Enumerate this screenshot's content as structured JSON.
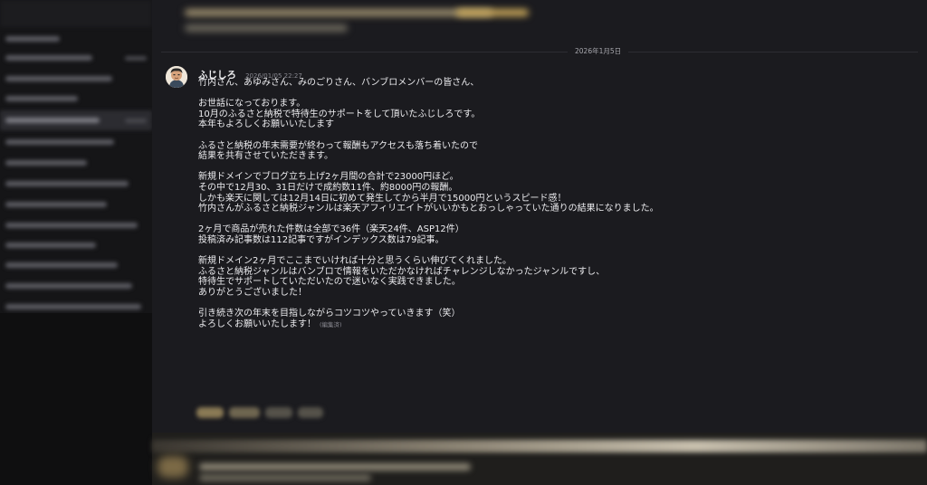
{
  "date_divider": "2026年1月5日",
  "message": {
    "author": "ふじしろ",
    "timestamp": "2026/01/05 22:27",
    "avatar_icon": "user-avatar-icon",
    "lines": [
      "竹内さん、あゆみさん、みのごりさん、バンブロメンバーの皆さん、",
      "",
      "お世話になっております。",
      "10月のふるさと納税で特待生のサポートをして頂いたふじしろです。",
      "本年もよろしくお願いいたします",
      "",
      "ふるさと納税の年末需要が終わって報酬もアクセスも落ち着いたので",
      "結果を共有させていただきます。",
      "",
      "新規ドメインでブログ立ち上げ2ヶ月間の合計で23000円ほど。",
      "その中で12月30、31日だけで成約数11件、約8000円の報酬。",
      "しかも楽天に関しては12月14日に初めて発生してから半月で15000円というスピード感！",
      "竹内さんがふるさと納税ジャンルは楽天アフィリエイトがいいかもとおっしゃっていた通りの結果になりました。",
      "",
      "2ヶ月で商品が売れた件数は全部で36件（楽天24件、ASP12件）",
      "投稿済み記事数は112記事ですがインデックス数は79記事。",
      "",
      "新規ドメイン2ヶ月でここまでいければ十分と思うくらい伸びてくれました。",
      "ふるさと納税ジャンルはバンブロで情報をいただかなければチャレンジしなかったジャンルですし、",
      "特待生でサポートしていただいたので迷いなく実践できました。",
      "ありがとうございました！",
      "",
      "引き続き次の年末を目指しながらコツコツやっていきます（笑）"
    ],
    "last_line": "よろしくお願いいたします！",
    "edited_label": "(編集済)"
  },
  "colors": {
    "background": "#1b1b1f",
    "sidebar": "#151517",
    "text": "#ececef",
    "muted": "#8a8a92"
  }
}
